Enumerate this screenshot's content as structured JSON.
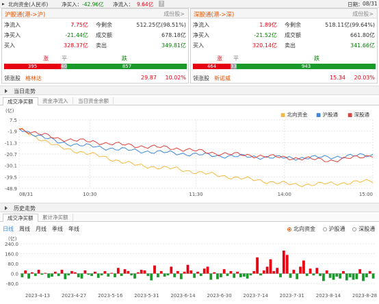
{
  "header": {
    "title": "北向资金(人民币)",
    "net_buy_label": "净买入：",
    "net_buy_value": "-42.96亿",
    "net_inflow_label": "净流入：",
    "net_inflow_value": "9.64亿",
    "help": "?",
    "date_label": "日期：",
    "date": "08/31"
  },
  "panels": [
    {
      "title": "沪股通(港->沪)",
      "more": "成份股>",
      "inflow_label": "净流入",
      "inflow": "7.75亿",
      "remain_label": "今剩余",
      "remain": "512.25亿(98.51%)",
      "netbuy_label": "净买入",
      "netbuy": "-21.44亿",
      "turnover_label": "成交额",
      "turnover": "678.18亿",
      "buy_label": "买入",
      "buy": "328.37亿",
      "sell_label": "卖出",
      "sell": "349.81亿",
      "up_label": "涨",
      "flat_label": "平",
      "down_label": "跌",
      "up": 395,
      "flat": 40,
      "down": 857,
      "lead_label": "领涨股",
      "lead_name": "格林达",
      "lead_price": "29.87",
      "lead_pct": "10.02%"
    },
    {
      "title": "深股通(港->深)",
      "more": "成份股>",
      "inflow_label": "净流入",
      "inflow": "1.89亿",
      "remain_label": "今剩余",
      "remain": "518.11亿(99.64%)",
      "netbuy_label": "净买入",
      "netbuy": "-21.52亿",
      "turnover_label": "成交额",
      "turnover": "661.80亿",
      "buy_label": "买入",
      "buy": "320.14亿",
      "sell_label": "卖出",
      "sell": "341.66亿",
      "up_label": "涨",
      "flat_label": "平",
      "down_label": "跌",
      "up": 464,
      "flat": 33,
      "down": 943,
      "lead_label": "领涨股",
      "lead_name": "新诺威",
      "lead_price": "15.34",
      "lead_pct": "20.03%"
    }
  ],
  "today": {
    "title": "当日走势",
    "tabs": [
      "成交净买额",
      "资金净流入",
      "当日资金余额"
    ],
    "unit": "(亿)",
    "yticks": [
      "7.5",
      "-1.9",
      "-11.3",
      "-20.7",
      "-30.1",
      "-39.5",
      "-48.9"
    ],
    "xticks": [
      "08/31",
      "10:30",
      "11:30",
      "14:00",
      "15:00"
    ],
    "legend": [
      "北向资金",
      "沪股通",
      "深股通"
    ],
    "colors": {
      "north": "#f5b942",
      "sh": "#3b87d9",
      "sz": "#e0413c"
    }
  },
  "history": {
    "title": "历史走势",
    "tabs": [
      "成交净买额",
      "累计净买额"
    ],
    "periods": [
      "日线",
      "周线",
      "月线",
      "季线",
      "年线"
    ],
    "radios": [
      "北向资金",
      "沪股通",
      "深股通"
    ],
    "unit": "(亿)",
    "yticks": [
      "240.0",
      "160.0",
      "80.0",
      "0.0",
      "-80.0"
    ],
    "xticks": [
      "2023-4-13",
      "2023-4-27",
      "2023-5-16",
      "2023-5-31",
      "2023-6-14",
      "2023-6-30",
      "2023-7-14",
      "2023-7-31",
      "2023-8-14",
      "2023-8-28"
    ]
  },
  "chart_data": [
    {
      "type": "line",
      "title": "当日走势",
      "ylabel": "(亿)",
      "ylim": [
        -48.9,
        7.5
      ],
      "x": [
        "08/31",
        "10:30",
        "11:30",
        "14:00",
        "15:00"
      ],
      "series": [
        {
          "name": "北向资金",
          "values": [
            0,
            -15,
            -22,
            -30,
            -33,
            -38,
            -42,
            -46,
            -45,
            -42.96
          ]
        },
        {
          "name": "沪股通",
          "values": [
            0,
            -11,
            -15,
            -18,
            -20,
            -22,
            -23,
            -24,
            -23,
            -21.44
          ]
        },
        {
          "name": "深股通",
          "values": [
            0,
            -8,
            -11,
            -14,
            -16,
            -20,
            -22,
            -24,
            -26,
            -21.52
          ]
        }
      ]
    },
    {
      "type": "bar",
      "title": "历史走势",
      "ylabel": "(亿)",
      "ylim": [
        -80,
        240
      ],
      "values": [
        -30,
        25,
        -40,
        10,
        -20,
        30,
        -10,
        5,
        -35,
        -25,
        15,
        -20,
        30,
        -45,
        -15,
        20,
        10,
        -30,
        -40,
        25,
        -10,
        -20,
        15,
        -35,
        -15,
        20,
        -25,
        5,
        -30,
        45,
        -20,
        35,
        20,
        -15,
        -40,
        10,
        30,
        25,
        -20,
        -55,
        65,
        -30,
        20,
        -25,
        -15,
        55,
        -30,
        20,
        -45,
        15,
        70,
        25,
        -35,
        15,
        -20,
        40,
        55,
        -50,
        10,
        -45,
        -30,
        35,
        -20,
        20,
        -35,
        15,
        -30,
        -25,
        -40,
        -15,
        20,
        130,
        -15,
        25,
        55,
        115,
        20,
        45,
        -30,
        185,
        150,
        -35,
        30,
        -45,
        55,
        105,
        -20,
        40,
        -15,
        45,
        -20,
        -60,
        25,
        -35,
        -50,
        -25,
        -40,
        20,
        -55,
        -30,
        -50,
        -45,
        35,
        -60,
        -30,
        20,
        -40
      ]
    }
  ]
}
